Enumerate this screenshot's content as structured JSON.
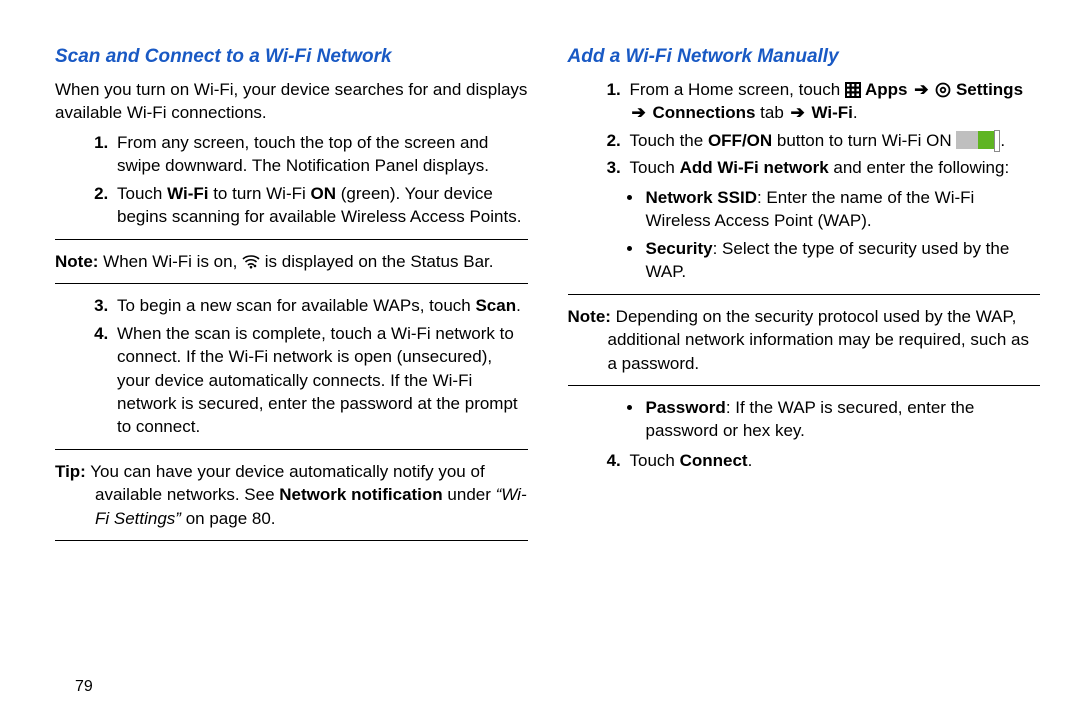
{
  "left": {
    "heading": "Scan and Connect to a Wi-Fi Network",
    "intro": "When you turn on Wi-Fi, your device searches for and displays available Wi-Fi connections.",
    "step1": "From any screen, touch the top of the screen and swipe downward. The Notification Panel displays.",
    "step2_a": "Touch ",
    "step2_b": "Wi-Fi",
    "step2_c": " to turn Wi-Fi ",
    "step2_d": "ON",
    "step2_e": " (green). Your device begins scanning for available Wireless Access Points.",
    "note1_label": "Note:",
    "note1_a": " When Wi-Fi is on, ",
    "note1_b": " is displayed on the Status Bar.",
    "step3_a": "To begin a new scan for available WAPs, touch ",
    "step3_b": "Scan",
    "step3_c": ".",
    "step4": "When the scan is complete, touch a Wi-Fi network to connect. If the Wi-Fi network is open (unsecured), your device automatically connects. If the Wi-Fi network is secured, enter the password at the prompt to connect.",
    "tip_label": "Tip:",
    "tip_a": " You can have your device automatically notify you of available networks. See ",
    "tip_b": "Network notification",
    "tip_c": " under ",
    "tip_d": "“Wi-Fi Settings”",
    "tip_e": " on page 80."
  },
  "right": {
    "heading": "Add a Wi-Fi Network Manually",
    "step1_a": "From a Home screen, touch ",
    "step1_apps": " Apps",
    "step1_settings": " Settings",
    "step1_conn": " Connections",
    "step1_tab": " tab ",
    "step1_wifi": " Wi-Fi",
    "step1_end": ".",
    "step2_a": "Touch the ",
    "step2_b": "OFF/ON",
    "step2_c": " button to turn Wi-Fi ON ",
    "step2_d": ".",
    "step3_a": "Touch ",
    "step3_b": "Add Wi-Fi network",
    "step3_c": " and enter the following:",
    "bul1_a": "Network SSID",
    "bul1_b": ": Enter the name of the Wi-Fi Wireless Access Point (WAP).",
    "bul2_a": "Security",
    "bul2_b": ": Select the type of security used by the WAP.",
    "note_label": "Note:",
    "note_a": " Depending on the security protocol used by the WAP, additional network information may be required, such as a password.",
    "bul3_a": "Password",
    "bul3_b": ": If the WAP is secured, enter the password or hex key.",
    "step4_a": "Touch ",
    "step4_b": "Connect",
    "step4_c": "."
  },
  "arrow": "➔",
  "page_number": "79"
}
